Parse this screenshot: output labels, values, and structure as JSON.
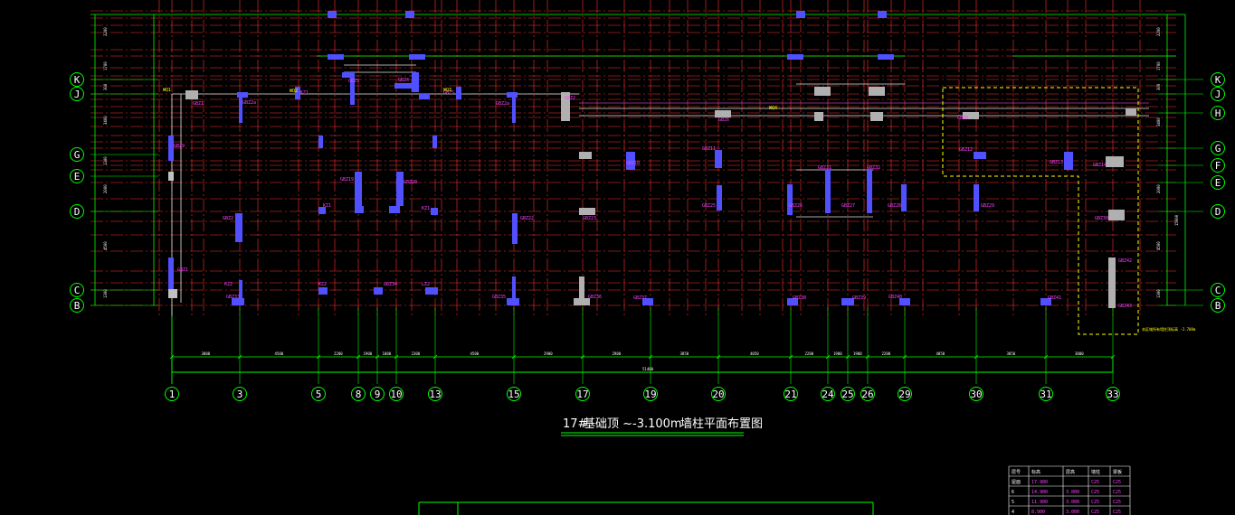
{
  "drawing": {
    "title_number": "17#",
    "title_main": "基础顶 ~-3.100m",
    "title_sub": "墙柱平面布置图",
    "overall_dim": "51400",
    "note": "本区域所有墙柱顶标高 -2.700m"
  },
  "axes": {
    "bottom": [
      "1",
      "3",
      "5",
      "8",
      "9",
      "10",
      "13",
      "15",
      "17",
      "19",
      "20",
      "21",
      "24",
      "25",
      "26",
      "29",
      "30",
      "31",
      "33"
    ],
    "left": [
      "K",
      "J",
      "G",
      "E",
      "D",
      "C",
      "B"
    ],
    "right": [
      "K",
      "J",
      "H",
      "G",
      "F",
      "E",
      "D",
      "C",
      "B"
    ]
  },
  "bottom_dims": [
    "3800",
    "4500",
    "2200",
    "1900",
    "1000",
    "2300",
    "4500",
    "2900",
    "2900",
    "3850",
    "4050",
    "2200",
    "1900",
    "1900",
    "2200",
    "4050",
    "3850",
    "3800"
  ],
  "left_dims": [
    "2200",
    "1700",
    "300",
    "3400",
    "1300",
    "2000",
    "4500",
    "1300"
  ],
  "right_dims": [
    "2200",
    "1700",
    "300",
    "3400",
    "2000",
    "4500",
    "1300",
    "15000"
  ],
  "column_tags": {
    "row_j": [
      "GBZ1",
      "GBZ2a",
      "KZ1",
      "GBZ3",
      "GBZ4",
      "GBZ5",
      "GBZ2a",
      "GBZ2",
      "GBZ6",
      "GBZ8"
    ],
    "row_g": [
      "GBZ9",
      "GBZ10",
      "GBZ11",
      "GBZ12",
      "GBZ13",
      "GBZ14"
    ],
    "row_d": [
      "GBZ2",
      "KZ1",
      "GBZ19",
      "GBZ20",
      "KZ1",
      "GBZ22",
      "GBZ23",
      "GBZ25",
      "GBZ26",
      "GBZ27",
      "GBZ28",
      "GBZ29",
      "GBZ30",
      "GBZ31",
      "GBZ32"
    ],
    "row_c": [
      "GBZ1",
      "GBZ33",
      "KZ2",
      "GBZ34",
      "LZ2",
      "GBZ35",
      "GBZ36",
      "GBZ37",
      "GBZ38",
      "GBZ39",
      "GBZ40",
      "GBZ41",
      "GBZ42",
      "GBZ43",
      "KZ2"
    ],
    "wall_tags": [
      "WQ1",
      "WQ2",
      "WQ3",
      "WQ4"
    ]
  },
  "table": {
    "header": [
      "层号",
      "标高",
      "层高",
      "墙柱",
      "梁板"
    ],
    "rows": [
      [
        "屋面",
        "17.900",
        "",
        "C25",
        "C25"
      ],
      [
        "6",
        "14.900",
        "3.000",
        "C25",
        "C25"
      ],
      [
        "5",
        "11.900",
        "3.000",
        "C25",
        "C25"
      ],
      [
        "4",
        "8.900",
        "3.000",
        "C25",
        "C25"
      ]
    ]
  }
}
